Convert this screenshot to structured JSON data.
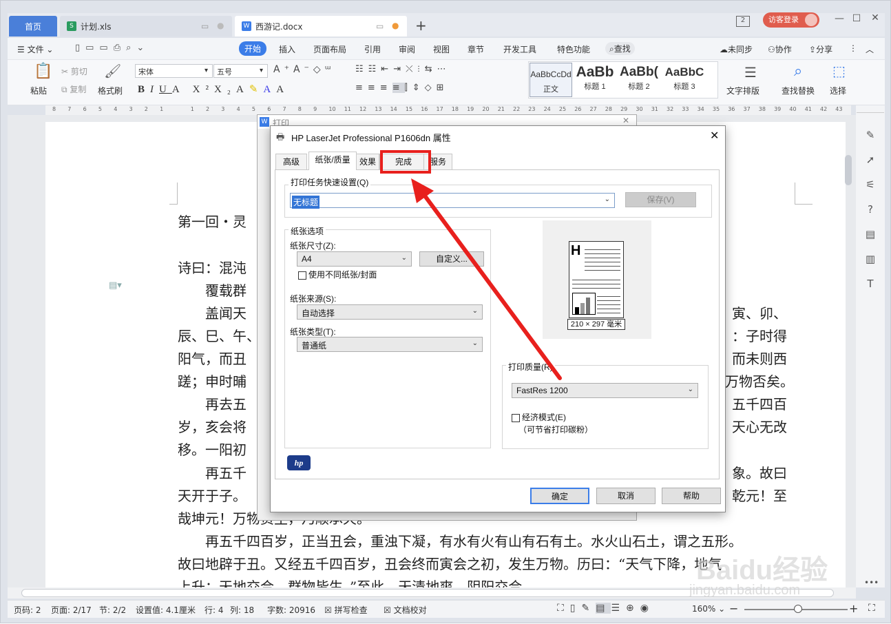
{
  "tabs": {
    "home": "首页",
    "xls": "计划.xls",
    "doc": "西游记.docx",
    "add": "+"
  },
  "login": "访客登录",
  "menus": [
    "文件",
    "开始",
    "插入",
    "页面布局",
    "引用",
    "审阅",
    "视图",
    "章节",
    "开发工具",
    "特色功能",
    "查找"
  ],
  "menu_right": [
    "未同步",
    "协作",
    "分享"
  ],
  "ribbon": {
    "paste": "粘贴",
    "cut": "剪切",
    "copy": "复制",
    "format_painter": "格式刷",
    "font": "宋体",
    "size": "五号",
    "styles": [
      {
        "preview": "AaBbCcDd",
        "name": "正文"
      },
      {
        "preview": "AaBb",
        "name": "标题 1"
      },
      {
        "preview": "AaBb(",
        "name": "标题 2"
      },
      {
        "preview": "AaBbC",
        "name": "标题 3"
      }
    ],
    "text_layout": "文字排版",
    "find_replace": "查找替换",
    "select": "选择"
  },
  "ruler_ticks": [
    "8",
    "7",
    "6",
    "5",
    "4",
    "3",
    "2",
    "1",
    "",
    "1",
    "2",
    "3",
    "4",
    "5",
    "6",
    "7",
    "8",
    "9",
    "10",
    "11",
    "12",
    "13",
    "14",
    "15",
    "16",
    "17",
    "18",
    "19",
    "20",
    "21",
    "22",
    "23",
    "24",
    "25",
    "26",
    "27",
    "28",
    "29",
    "30",
    "31",
    "32",
    "33",
    "34",
    "35",
    "36",
    "37",
    "38",
    "39",
    "40",
    "41",
    "42",
    "43"
  ],
  "doc_lines": [
    {
      "left": "第一回・灵",
      "right": ""
    },
    {
      "left": "诗曰：混沌",
      "right": ""
    },
    {
      "left": "　　覆载群",
      "right": ""
    },
    {
      "left": "　　盖闻天",
      "right": "寅、卯、"
    },
    {
      "left": "辰、巳、午、",
      "right": "：子时得"
    },
    {
      "left": "阳气，而丑",
      "right": "而未则西"
    },
    {
      "left": "蹉；申时晡",
      "right": "万物否矣。"
    },
    {
      "left": "　　再去五",
      "right": "五千四百"
    },
    {
      "left": "岁，亥会将",
      "right": "天心无改"
    },
    {
      "left": "移。一阳初",
      "right": ""
    },
    {
      "left": "　　再五千",
      "right": "象。故曰"
    },
    {
      "left": "天开于子。",
      "right": "乾元！至"
    },
    {
      "left": "哉坤元！万物资生，乃顺承天。",
      "right": ""
    },
    {
      "left": "　　再五千四百岁，正当丑会，重浊下凝，有水有火有山有石有土。水火山石土，谓之五形。",
      "right": ""
    },
    {
      "left": "故曰地辟于丑。又经五千四百岁，丑会终而寅会之初，发生万物。历曰：“天气下降，地气",
      "right": ""
    },
    {
      "left": "上升；天地交合，群物皆生。”至此，天清地爽，阴阳交合。",
      "right": ""
    }
  ],
  "print_dialog": {
    "title": "打印"
  },
  "props": {
    "title": "HP LaserJet Professional P1606dn 属性",
    "tabs": [
      "高级",
      "纸张/质量",
      "效果",
      "完成",
      "服务"
    ],
    "quick_set_label": "打印任务快速设置(Q)",
    "quick_set_value": "无标题",
    "save": "保存(V)",
    "paper_options": "纸张选项",
    "paper_size_label": "纸张尺寸(Z):",
    "paper_size": "A4",
    "custom": "自定义...",
    "diff_paper": "使用不同纸张/封面",
    "paper_source_label": "纸张来源(S):",
    "paper_source": "自动选择",
    "paper_type_label": "纸张类型(T):",
    "paper_type": "普通纸",
    "preview_size": "210 × 297 毫米",
    "quality_label": "打印质量(R)",
    "quality": "FastRes 1200",
    "eco": "经济模式(E)",
    "eco_note": "（可节省打印碳粉）",
    "hp": "hp",
    "ok": "确定",
    "cancel": "取消",
    "help": "帮助"
  },
  "status": {
    "page_num": "页码: 2",
    "pages": "页面: 2/17",
    "section": "节: 2/2",
    "setting": "设置值: 4.1厘米",
    "row": "行: 4",
    "col": "列: 18",
    "words": "字数: 20916",
    "spell": "拼写检查",
    "proof": "文档校对",
    "zoom": "160%"
  },
  "watermark": {
    "brand": "Baidu经验",
    "url": "jingyan.baidu.com"
  },
  "colors": {
    "accent": "#3b7de8",
    "highlight": "#e8201d",
    "login": "#e05d4e"
  }
}
